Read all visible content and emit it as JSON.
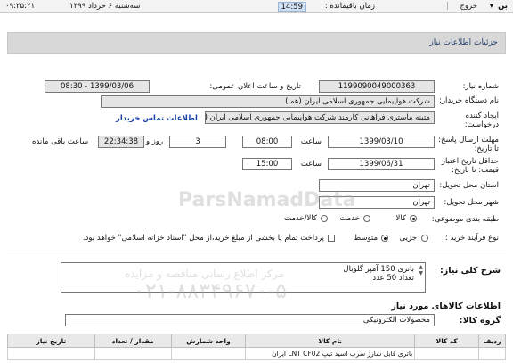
{
  "topbar": {
    "menu": "بن",
    "exit": "خروج",
    "server_time_label": "زمان باقیمانده :",
    "server_time": "14:59",
    "date": "سه‌شنبه ۶ خرداد ۱۳۹۹",
    "clock": "۰۹:۲۵:۲۱"
  },
  "header": {
    "title": "جزئیات اطلاعات نیاز"
  },
  "form": {
    "need_number_label": "شماره نیاز:",
    "need_number": "1199090049000363",
    "announce_label": "تاریخ و ساعت اعلان عمومی:",
    "announce_value": "1399/03/06 - 08:30",
    "buyer_label": "نام دستگاه خریدار:",
    "buyer_value": "شرکت هواپیمایی جمهوری اسلامی ایران (هما)",
    "creator_label": "ایجاد کننده درخواست:",
    "creator_value": "متینه ماستری فراهانی کارمند شرکت هواپیمایی جمهوری اسلامی ایران (هما)",
    "contact_link": "اطلاعات تماس خریدار",
    "deadline_label": "مهلت ارسال پاسخ: تا تاریخ:",
    "deadline_date": "1399/03/10",
    "time_label": "ساعت",
    "deadline_time": "08:00",
    "days_value": "3",
    "days_label": "روز و",
    "remaining_time": "22:34:38",
    "remaining_label": "ساعت باقی مانده",
    "validity_label": "حداقل تاریخ اعتبار قیمت: تا تاریخ:",
    "validity_date": "1399/06/31",
    "validity_time": "15:00",
    "province_label": "استان محل تحویل:",
    "province_value": "تهران",
    "city_label": "شهر محل تحویل:",
    "city_value": "تهران",
    "category_label": "طبقه بندی موضوعی:",
    "category_options": [
      "کالا",
      "خدمت",
      "کالا/خدمت"
    ],
    "category_selected": "کالا",
    "process_label": "نوع فرآیند خرید :",
    "process_options": [
      "جزیی",
      "متوسط"
    ],
    "process_selected": "متوسط",
    "payment_note": "پرداخت تمام یا بخشی از مبلغ خرید،از محل \"اسناد خزانه اسلامی\" خواهد بود."
  },
  "summary": {
    "label": "شرح کلی نیاز:",
    "line1": "باتری 150 آمپر گلوبال",
    "line2": "تعداد 50 عدد"
  },
  "goods": {
    "section_title": "اطلاعات کالاهای مورد نیاز",
    "group_label": "گروه کالا:",
    "group_value": "محصولات الکترونیکی"
  },
  "table": {
    "headers": [
      "ردیف",
      "کد کالا",
      "نام کالا",
      "واحد شمارش",
      "مقدار / تعداد",
      "تاریخ نیاز"
    ],
    "row1_name": "باتری قابل شارژ سرب اسید تیپ LNT CF02 ایران"
  },
  "watermark": {
    "brand": "ParsNamadData",
    "phone": "۰۲۱-۸۸۳۴۹۶۷۰-۵",
    "line": "مرکز اطلاع رسانی مناقصه و مزایده"
  },
  "colors": {
    "header_bg": "#d8d8d8",
    "link": "#1a3fa8",
    "time_box": "#cfe0f5"
  }
}
